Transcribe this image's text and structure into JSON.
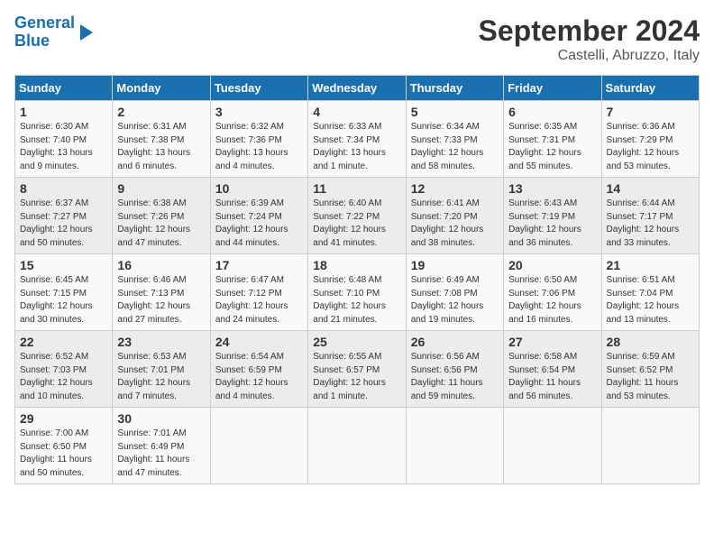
{
  "header": {
    "logo_line1": "General",
    "logo_line2": "Blue",
    "title": "September 2024",
    "subtitle": "Castelli, Abruzzo, Italy"
  },
  "columns": [
    "Sunday",
    "Monday",
    "Tuesday",
    "Wednesday",
    "Thursday",
    "Friday",
    "Saturday"
  ],
  "weeks": [
    [
      {
        "day": "1",
        "info": "Sunrise: 6:30 AM\nSunset: 7:40 PM\nDaylight: 13 hours\nand 9 minutes."
      },
      {
        "day": "2",
        "info": "Sunrise: 6:31 AM\nSunset: 7:38 PM\nDaylight: 13 hours\nand 6 minutes."
      },
      {
        "day": "3",
        "info": "Sunrise: 6:32 AM\nSunset: 7:36 PM\nDaylight: 13 hours\nand 4 minutes."
      },
      {
        "day": "4",
        "info": "Sunrise: 6:33 AM\nSunset: 7:34 PM\nDaylight: 13 hours\nand 1 minute."
      },
      {
        "day": "5",
        "info": "Sunrise: 6:34 AM\nSunset: 7:33 PM\nDaylight: 12 hours\nand 58 minutes."
      },
      {
        "day": "6",
        "info": "Sunrise: 6:35 AM\nSunset: 7:31 PM\nDaylight: 12 hours\nand 55 minutes."
      },
      {
        "day": "7",
        "info": "Sunrise: 6:36 AM\nSunset: 7:29 PM\nDaylight: 12 hours\nand 53 minutes."
      }
    ],
    [
      {
        "day": "8",
        "info": "Sunrise: 6:37 AM\nSunset: 7:27 PM\nDaylight: 12 hours\nand 50 minutes."
      },
      {
        "day": "9",
        "info": "Sunrise: 6:38 AM\nSunset: 7:26 PM\nDaylight: 12 hours\nand 47 minutes."
      },
      {
        "day": "10",
        "info": "Sunrise: 6:39 AM\nSunset: 7:24 PM\nDaylight: 12 hours\nand 44 minutes."
      },
      {
        "day": "11",
        "info": "Sunrise: 6:40 AM\nSunset: 7:22 PM\nDaylight: 12 hours\nand 41 minutes."
      },
      {
        "day": "12",
        "info": "Sunrise: 6:41 AM\nSunset: 7:20 PM\nDaylight: 12 hours\nand 38 minutes."
      },
      {
        "day": "13",
        "info": "Sunrise: 6:43 AM\nSunset: 7:19 PM\nDaylight: 12 hours\nand 36 minutes."
      },
      {
        "day": "14",
        "info": "Sunrise: 6:44 AM\nSunset: 7:17 PM\nDaylight: 12 hours\nand 33 minutes."
      }
    ],
    [
      {
        "day": "15",
        "info": "Sunrise: 6:45 AM\nSunset: 7:15 PM\nDaylight: 12 hours\nand 30 minutes."
      },
      {
        "day": "16",
        "info": "Sunrise: 6:46 AM\nSunset: 7:13 PM\nDaylight: 12 hours\nand 27 minutes."
      },
      {
        "day": "17",
        "info": "Sunrise: 6:47 AM\nSunset: 7:12 PM\nDaylight: 12 hours\nand 24 minutes."
      },
      {
        "day": "18",
        "info": "Sunrise: 6:48 AM\nSunset: 7:10 PM\nDaylight: 12 hours\nand 21 minutes."
      },
      {
        "day": "19",
        "info": "Sunrise: 6:49 AM\nSunset: 7:08 PM\nDaylight: 12 hours\nand 19 minutes."
      },
      {
        "day": "20",
        "info": "Sunrise: 6:50 AM\nSunset: 7:06 PM\nDaylight: 12 hours\nand 16 minutes."
      },
      {
        "day": "21",
        "info": "Sunrise: 6:51 AM\nSunset: 7:04 PM\nDaylight: 12 hours\nand 13 minutes."
      }
    ],
    [
      {
        "day": "22",
        "info": "Sunrise: 6:52 AM\nSunset: 7:03 PM\nDaylight: 12 hours\nand 10 minutes."
      },
      {
        "day": "23",
        "info": "Sunrise: 6:53 AM\nSunset: 7:01 PM\nDaylight: 12 hours\nand 7 minutes."
      },
      {
        "day": "24",
        "info": "Sunrise: 6:54 AM\nSunset: 6:59 PM\nDaylight: 12 hours\nand 4 minutes."
      },
      {
        "day": "25",
        "info": "Sunrise: 6:55 AM\nSunset: 6:57 PM\nDaylight: 12 hours\nand 1 minute."
      },
      {
        "day": "26",
        "info": "Sunrise: 6:56 AM\nSunset: 6:56 PM\nDaylight: 11 hours\nand 59 minutes."
      },
      {
        "day": "27",
        "info": "Sunrise: 6:58 AM\nSunset: 6:54 PM\nDaylight: 11 hours\nand 56 minutes."
      },
      {
        "day": "28",
        "info": "Sunrise: 6:59 AM\nSunset: 6:52 PM\nDaylight: 11 hours\nand 53 minutes."
      }
    ],
    [
      {
        "day": "29",
        "info": "Sunrise: 7:00 AM\nSunset: 6:50 PM\nDaylight: 11 hours\nand 50 minutes."
      },
      {
        "day": "30",
        "info": "Sunrise: 7:01 AM\nSunset: 6:49 PM\nDaylight: 11 hours\nand 47 minutes."
      },
      {
        "day": "",
        "info": ""
      },
      {
        "day": "",
        "info": ""
      },
      {
        "day": "",
        "info": ""
      },
      {
        "day": "",
        "info": ""
      },
      {
        "day": "",
        "info": ""
      }
    ]
  ]
}
